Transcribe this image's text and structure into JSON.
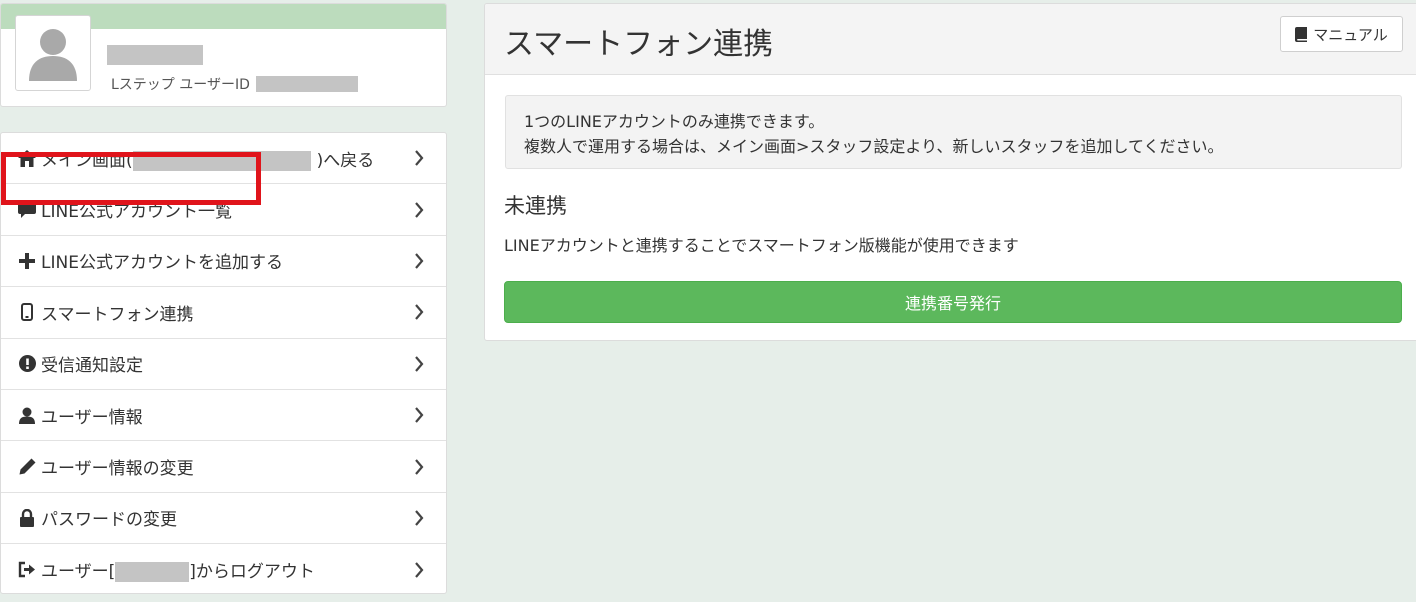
{
  "profile": {
    "userid_label": "Lステップ ユーザーID"
  },
  "menu": {
    "items": [
      {
        "label_prefix": "メイン画面(",
        "label_suffix": ")へ戻る",
        "icon": "home-icon"
      },
      {
        "label": "LINE公式アカウント一覧",
        "icon": "comment-icon"
      },
      {
        "label": "LINE公式アカウントを追加する",
        "icon": "plus-icon"
      },
      {
        "label": "スマートフォン連携",
        "icon": "mobile-icon"
      },
      {
        "label": "受信通知設定",
        "icon": "exclamation-circle-icon"
      },
      {
        "label": "ユーザー情報",
        "icon": "user-icon"
      },
      {
        "label": "ユーザー情報の変更",
        "icon": "pencil-icon"
      },
      {
        "label": "パスワードの変更",
        "icon": "lock-icon"
      },
      {
        "label_prefix": "ユーザー[",
        "label_suffix": "]からログアウト",
        "icon": "logout-icon"
      }
    ]
  },
  "panel": {
    "title": "スマートフォン連携",
    "manual_button": "マニュアル",
    "notice_line1": "1つのLINEアカウントのみ連携できます。",
    "notice_line2": "複数人で運用する場合は、メイン画面>スタッフ設定より、新しいスタッフを追加してください。",
    "status_heading": "未連携",
    "status_description": "LINEアカウントと連携することでスマートフォン版機能が使用できます",
    "issue_button": "連携番号発行"
  },
  "colors": {
    "accent_green": "#5cb85c",
    "highlight_red": "#e0141b",
    "header_band": "#bcdcbd"
  }
}
